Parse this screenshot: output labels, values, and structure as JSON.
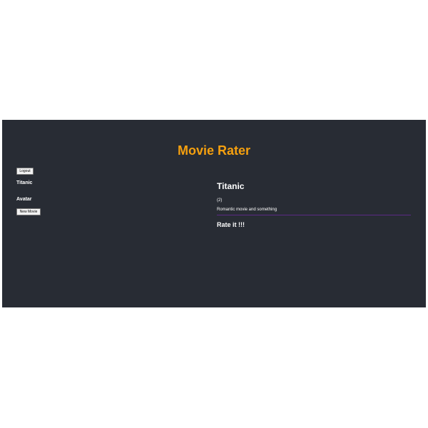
{
  "app": {
    "title": "Movie Rater"
  },
  "toolbar": {
    "logout_label": "Logout",
    "new_movie_label": "New Movie"
  },
  "movies": [
    {
      "title": "Titanic"
    },
    {
      "title": "Avatar"
    }
  ],
  "details": {
    "title": "Titanic",
    "rating": "(2)",
    "description": "Romantic movie and something",
    "rate_heading": "Rate it !!!"
  },
  "colors": {
    "background": "#282c34",
    "title_accent": "#f5a00f",
    "divider": "#5b2a86"
  }
}
